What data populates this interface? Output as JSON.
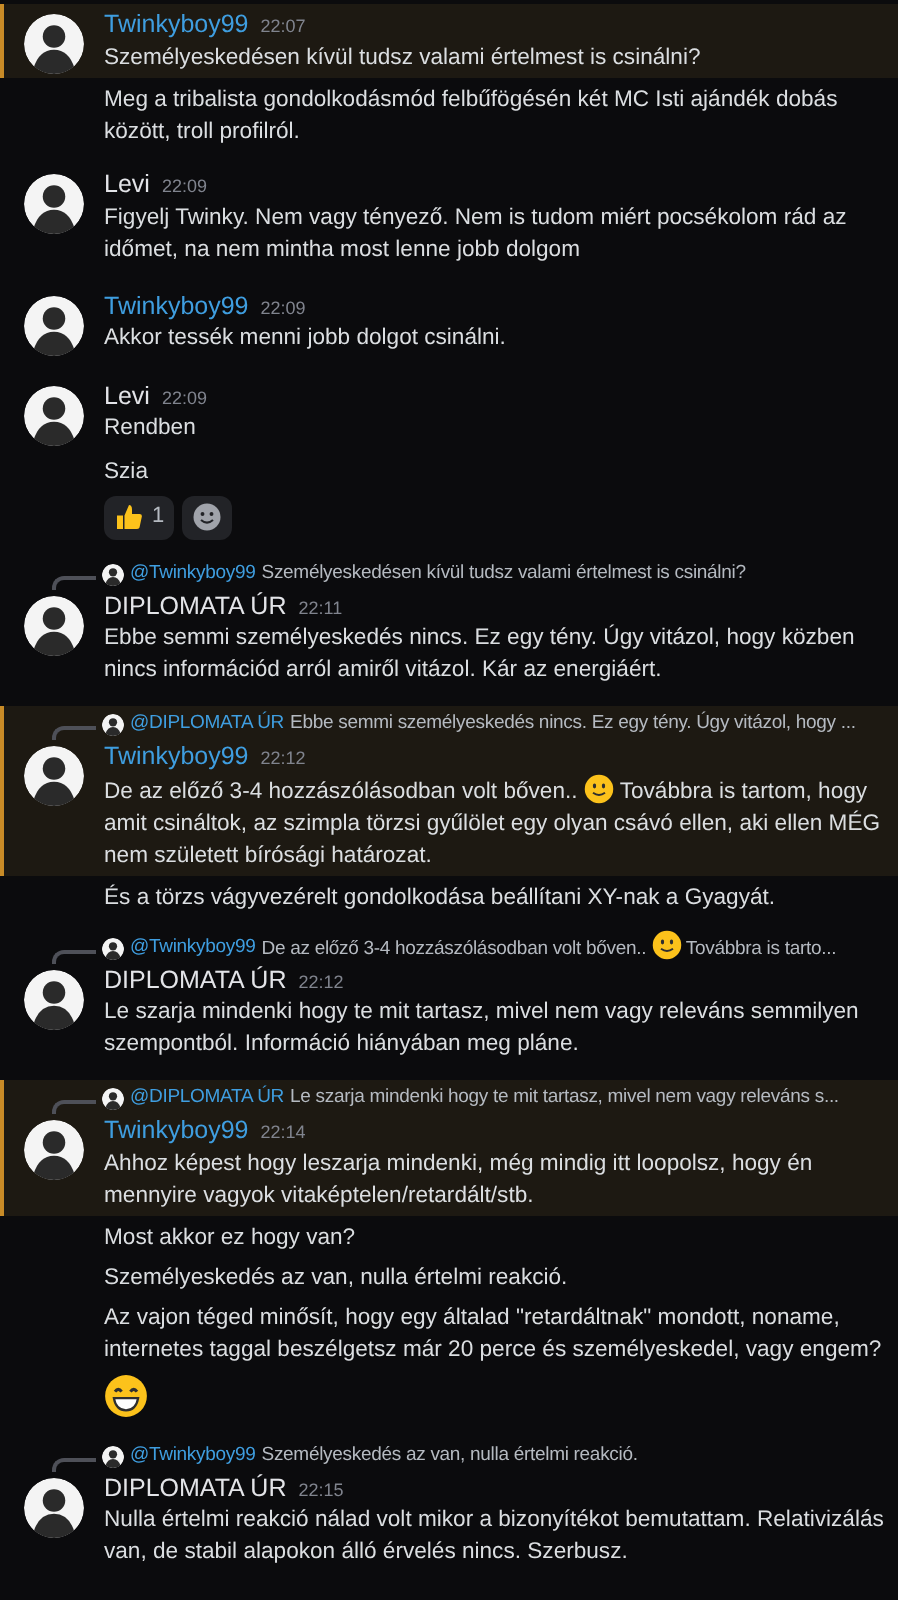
{
  "messages": [
    {
      "author": "Twinkyboy99",
      "color": "#3f9ee0",
      "time": "22:07",
      "highlighted": true,
      "lines": [
        [
          {
            "kind": "text",
            "text": "Személyeskedésen kívül tudsz valami értelmest is csinálni?"
          }
        ]
      ],
      "followups": [
        [
          {
            "kind": "text",
            "text": "Meg a tribalista gondolkodásmód felbűfögésén két MC Isti ajándék dobás között, troll profilról."
          }
        ]
      ]
    },
    {
      "author": "Levi",
      "color": "#e3e4e8",
      "time": "22:09",
      "highlighted": false,
      "lines": [
        [
          {
            "kind": "text",
            "text": "Figyelj Twinky. Nem vagy tényező. Nem is tudom miért pocsékolom rád az időmet, na nem mintha most lenne jobb dolgom"
          }
        ]
      ]
    },
    {
      "author": "Twinkyboy99",
      "color": "#3f9ee0",
      "time": "22:09",
      "highlighted": false,
      "lines": [
        [
          {
            "kind": "text",
            "text": "Akkor tessék menni jobb dolgot csinálni."
          }
        ]
      ]
    },
    {
      "author": "Levi",
      "color": "#e3e4e8",
      "time": "22:09",
      "highlighted": false,
      "lines": [
        [
          {
            "kind": "text",
            "text": "Rendben"
          }
        ]
      ],
      "followups": [
        [
          {
            "kind": "text",
            "text": "Szia"
          }
        ]
      ],
      "reactions": [
        {
          "kind": "thumbs",
          "count": "1"
        },
        {
          "kind": "add"
        }
      ]
    },
    {
      "author": "DIPLOMATA ÚR",
      "color": "#e3e4e8",
      "time": "22:11",
      "highlighted": false,
      "reply": {
        "mention": "@Twinkyboy99",
        "text": "Személyeskedésen kívül tudsz valami értelmest is csinálni?"
      },
      "lines": [
        [
          {
            "kind": "text",
            "text": "Ebbe semmi személyeskedés nincs. Ez egy tény. Úgy vitázol, hogy közben nincs információd arról amiről vitázol. Kár az energiáért."
          }
        ]
      ]
    },
    {
      "author": "Twinkyboy99",
      "color": "#3f9ee0",
      "time": "22:12",
      "highlighted": true,
      "reply": {
        "mention": "@DIPLOMATA ÚR",
        "text": "Ebbe semmi személyeskedés nincs. Ez egy tény. Úgy vitázol, hogy ..."
      },
      "lines": [
        [
          {
            "kind": "text",
            "text": "De az előző 3-4 hozzászólásodban volt bőven.. "
          },
          {
            "kind": "smile"
          },
          {
            "kind": "text",
            "text": " Továbbra is tartom, hogy amit csináltok, az szimpla törzsi gyűlölet egy olyan csávó ellen, aki ellen MÉG nem született bírósági határozat."
          }
        ]
      ],
      "followups": [
        [
          {
            "kind": "text",
            "text": "És a törzs vágyvezérelt gondolkodása beállítani XY-nak a Gyagyát."
          }
        ]
      ]
    },
    {
      "author": "DIPLOMATA ÚR",
      "color": "#e3e4e8",
      "time": "22:12",
      "highlighted": false,
      "reply": {
        "mention": "@Twinkyboy99",
        "text": "De az előző 3-4 hozzászólásodban volt bőven.. ",
        "after_emoji": " Továbbra is tarto..."
      },
      "lines": [
        [
          {
            "kind": "text",
            "text": "Le szarja mindenki hogy te mit tartasz, mivel nem vagy releváns semmilyen szempontból. Információ hiányában meg pláne."
          }
        ]
      ]
    },
    {
      "author": "Twinkyboy99",
      "color": "#3f9ee0",
      "time": "22:14",
      "highlighted": true,
      "reply": {
        "mention": "@DIPLOMATA ÚR",
        "text": "Le szarja mindenki hogy te mit tartasz, mivel nem vagy releváns s..."
      },
      "lines": [
        [
          {
            "kind": "text",
            "text": "Ahhoz képest hogy leszarja mindenki, még mindig itt loopolsz, hogy én mennyire vagyok vitaképtelen/retardált/stb."
          }
        ]
      ],
      "followups": [
        [
          {
            "kind": "text",
            "text": "Most akkor ez hogy van?"
          }
        ],
        [
          {
            "kind": "text",
            "text": "Személyeskedés az van, nulla értelmi reakció."
          }
        ],
        [
          {
            "kind": "text",
            "text": "Az vajon téged minősít, hogy egy általad \"retardáltnak\" mondott, noname, internetes taggal beszélgetsz már 20 perce és személyeskedel, vagy engem?"
          }
        ],
        [
          {
            "kind": "grin"
          }
        ]
      ]
    },
    {
      "author": "DIPLOMATA ÚR",
      "color": "#e3e4e8",
      "time": "22:15",
      "highlighted": false,
      "reply": {
        "mention": "@Twinkyboy99",
        "text": "Személyeskedés az van, nulla értelmi reakció."
      },
      "lines": [
        [
          {
            "kind": "text",
            "text": "Nulla értelmi reakció nálad volt mikor a bizonyítékot bemutattam. Relativizálás van, de stabil alapokon álló érvelés nincs. Szerbusz."
          }
        ]
      ]
    }
  ]
}
